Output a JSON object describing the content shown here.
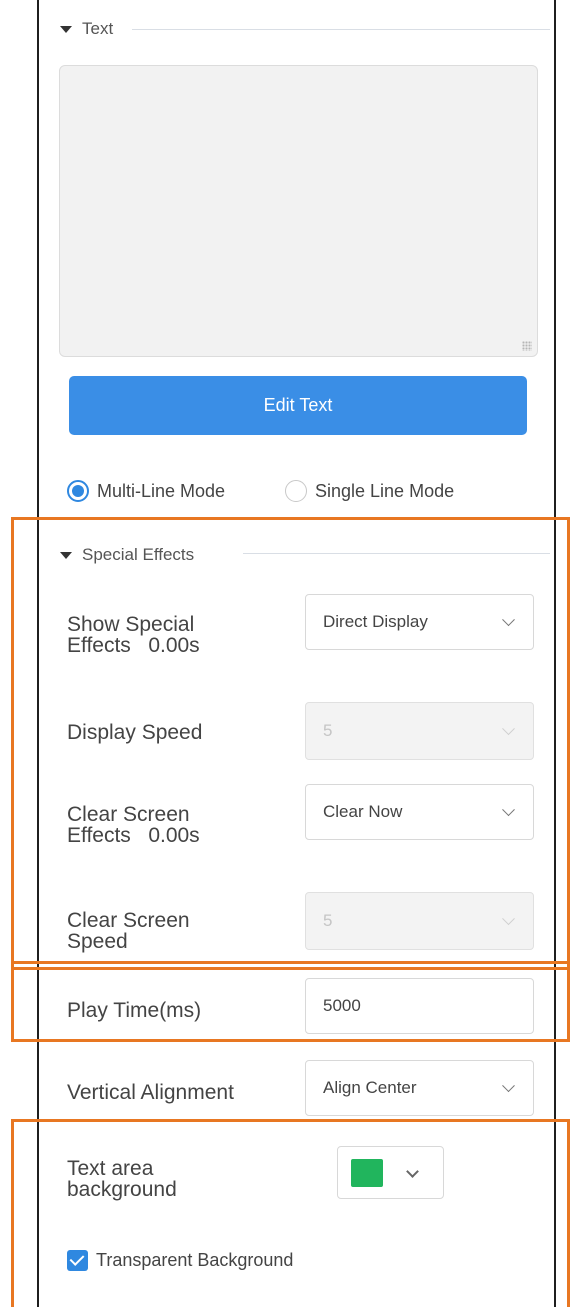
{
  "text_section": {
    "title": "Text",
    "edit_button": "Edit Text",
    "modes": [
      {
        "label": "Multi-Line Mode",
        "checked": true
      },
      {
        "label": "Single Line Mode",
        "checked": false
      }
    ]
  },
  "effects_section": {
    "title": "Special Effects",
    "show_effects": {
      "label_line1": "Show Special",
      "label_line2": "Effects   0.00s",
      "value": "Direct Display"
    },
    "display_speed": {
      "label": "Display Speed",
      "value": "5"
    },
    "clear_effects": {
      "label_line1": "Clear Screen",
      "label_line2": "Effects   0.00s",
      "value": "Clear Now"
    },
    "clear_speed": {
      "label_line1": "Clear Screen",
      "label_line2": "Speed",
      "value": "5"
    }
  },
  "play_time": {
    "label": "Play Time(ms)",
    "value": "5000"
  },
  "vertical_alignment": {
    "label": "Vertical Alignment",
    "value": "Align Center"
  },
  "background": {
    "label_line1": "Text area",
    "label_line2": "background",
    "color": "#21b55d",
    "transparent_label": "Transparent Background",
    "transparent_checked": true
  },
  "colors": {
    "accent": "#3a8ee6",
    "highlight": "#e87722",
    "checkbox": "#2f88e0"
  }
}
